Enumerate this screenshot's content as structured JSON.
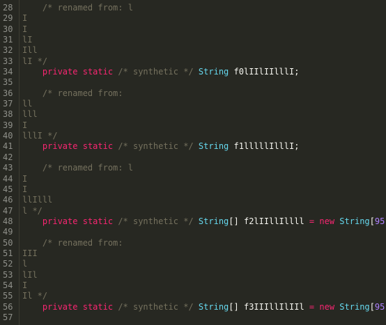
{
  "editor": {
    "lines": [
      {
        "n": "28",
        "indent": "    ",
        "tokens": [
          {
            "cls": "c",
            "text": "/* renamed from: l"
          }
        ]
      },
      {
        "n": "29",
        "indent": "",
        "tokens": [
          {
            "cls": "c",
            "text": "I"
          }
        ]
      },
      {
        "n": "30",
        "indent": "",
        "tokens": [
          {
            "cls": "c",
            "text": "I"
          }
        ]
      },
      {
        "n": "31",
        "indent": "",
        "tokens": [
          {
            "cls": "c",
            "text": "lI"
          }
        ]
      },
      {
        "n": "32",
        "indent": "",
        "tokens": [
          {
            "cls": "c",
            "text": "Ill"
          }
        ]
      },
      {
        "n": "33",
        "indent": "",
        "tokens": [
          {
            "cls": "c",
            "text": "lI */"
          }
        ]
      },
      {
        "n": "34",
        "indent": "    ",
        "tokens": [
          {
            "cls": "k",
            "text": "private"
          },
          {
            "cls": "p",
            "text": " "
          },
          {
            "cls": "k",
            "text": "static"
          },
          {
            "cls": "p",
            "text": " "
          },
          {
            "cls": "c",
            "text": "/* synthetic */"
          },
          {
            "cls": "p",
            "text": " "
          },
          {
            "cls": "t",
            "text": "String"
          },
          {
            "cls": "p",
            "text": " "
          },
          {
            "cls": "n",
            "text": "f0lIIlIIlllI"
          },
          {
            "cls": "p",
            "text": ";"
          }
        ]
      },
      {
        "n": "35",
        "indent": "",
        "tokens": []
      },
      {
        "n": "36",
        "indent": "    ",
        "tokens": [
          {
            "cls": "c",
            "text": "/* renamed from:"
          }
        ]
      },
      {
        "n": "37",
        "indent": "",
        "tokens": [
          {
            "cls": "c",
            "text": "ll"
          }
        ]
      },
      {
        "n": "38",
        "indent": "",
        "tokens": [
          {
            "cls": "c",
            "text": "lll"
          }
        ]
      },
      {
        "n": "39",
        "indent": "",
        "tokens": [
          {
            "cls": "c",
            "text": "I"
          }
        ]
      },
      {
        "n": "40",
        "indent": "",
        "tokens": [
          {
            "cls": "c",
            "text": "lllI */"
          }
        ]
      },
      {
        "n": "41",
        "indent": "    ",
        "tokens": [
          {
            "cls": "k",
            "text": "private"
          },
          {
            "cls": "p",
            "text": " "
          },
          {
            "cls": "k",
            "text": "static"
          },
          {
            "cls": "p",
            "text": " "
          },
          {
            "cls": "c",
            "text": "/* synthetic */"
          },
          {
            "cls": "p",
            "text": " "
          },
          {
            "cls": "t",
            "text": "String"
          },
          {
            "cls": "p",
            "text": " "
          },
          {
            "cls": "n",
            "text": "f1lllllIlllI"
          },
          {
            "cls": "p",
            "text": ";"
          }
        ]
      },
      {
        "n": "42",
        "indent": "",
        "tokens": []
      },
      {
        "n": "43",
        "indent": "    ",
        "tokens": [
          {
            "cls": "c",
            "text": "/* renamed from: l"
          }
        ]
      },
      {
        "n": "44",
        "indent": "",
        "tokens": [
          {
            "cls": "c",
            "text": "I"
          }
        ]
      },
      {
        "n": "45",
        "indent": "",
        "tokens": [
          {
            "cls": "c",
            "text": "I"
          }
        ]
      },
      {
        "n": "46",
        "indent": "",
        "tokens": [
          {
            "cls": "c",
            "text": "llIlll"
          }
        ]
      },
      {
        "n": "47",
        "indent": "",
        "tokens": [
          {
            "cls": "c",
            "text": "l */"
          }
        ]
      },
      {
        "n": "48",
        "indent": "    ",
        "tokens": [
          {
            "cls": "k",
            "text": "private"
          },
          {
            "cls": "p",
            "text": " "
          },
          {
            "cls": "k",
            "text": "static"
          },
          {
            "cls": "p",
            "text": " "
          },
          {
            "cls": "c",
            "text": "/* synthetic */"
          },
          {
            "cls": "p",
            "text": " "
          },
          {
            "cls": "t",
            "text": "String"
          },
          {
            "cls": "p",
            "text": "[] "
          },
          {
            "cls": "n",
            "text": "f2lIIllIllll"
          },
          {
            "cls": "p",
            "text": " "
          },
          {
            "cls": "o",
            "text": "="
          },
          {
            "cls": "p",
            "text": " "
          },
          {
            "cls": "k",
            "text": "new"
          },
          {
            "cls": "p",
            "text": " "
          },
          {
            "cls": "t",
            "text": "String"
          },
          {
            "cls": "p",
            "text": "["
          },
          {
            "cls": "num",
            "text": "95"
          },
          {
            "cls": "p",
            "text": "];"
          }
        ]
      },
      {
        "n": "49",
        "indent": "",
        "tokens": []
      },
      {
        "n": "50",
        "indent": "    ",
        "tokens": [
          {
            "cls": "c",
            "text": "/* renamed from:"
          }
        ]
      },
      {
        "n": "51",
        "indent": "",
        "tokens": [
          {
            "cls": "c",
            "text": "III"
          }
        ]
      },
      {
        "n": "52",
        "indent": "",
        "tokens": [
          {
            "cls": "c",
            "text": "l"
          }
        ]
      },
      {
        "n": "53",
        "indent": "",
        "tokens": [
          {
            "cls": "c",
            "text": "lIl"
          }
        ]
      },
      {
        "n": "54",
        "indent": "",
        "tokens": [
          {
            "cls": "c",
            "text": "I"
          }
        ]
      },
      {
        "n": "55",
        "indent": "",
        "tokens": [
          {
            "cls": "c",
            "text": "Il */"
          }
        ]
      },
      {
        "n": "56",
        "indent": "    ",
        "tokens": [
          {
            "cls": "k",
            "text": "private"
          },
          {
            "cls": "p",
            "text": " "
          },
          {
            "cls": "k",
            "text": "static"
          },
          {
            "cls": "p",
            "text": " "
          },
          {
            "cls": "c",
            "text": "/* synthetic */"
          },
          {
            "cls": "p",
            "text": " "
          },
          {
            "cls": "t",
            "text": "String"
          },
          {
            "cls": "p",
            "text": "[] "
          },
          {
            "cls": "n",
            "text": "f3IIIllIlIIl"
          },
          {
            "cls": "p",
            "text": " "
          },
          {
            "cls": "o",
            "text": "="
          },
          {
            "cls": "p",
            "text": " "
          },
          {
            "cls": "k",
            "text": "new"
          },
          {
            "cls": "p",
            "text": " "
          },
          {
            "cls": "t",
            "text": "String"
          },
          {
            "cls": "p",
            "text": "["
          },
          {
            "cls": "num",
            "text": "95"
          },
          {
            "cls": "p",
            "text": "];"
          }
        ]
      },
      {
        "n": "57",
        "indent": "",
        "tokens": []
      }
    ]
  },
  "colors": {
    "background": "#272822",
    "line_number": "#8F908A",
    "comment": "#75715E",
    "keyword": "#F92672",
    "type": "#66D9EF",
    "number": "#AE81FF",
    "text": "#F8F8F2"
  }
}
